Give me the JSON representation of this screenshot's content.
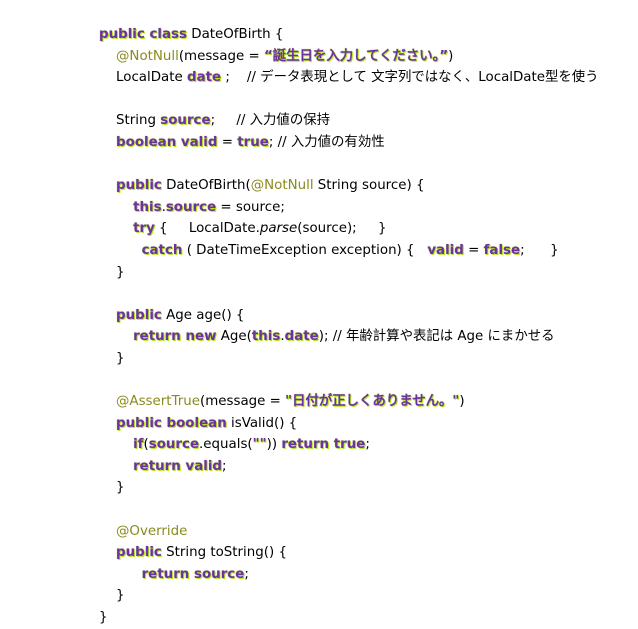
{
  "code": {
    "lines": [
      [
        [
          "kw",
          "public class"
        ],
        [
          "t",
          " DateOfBirth {"
        ]
      ],
      [
        [
          "t",
          "    "
        ],
        [
          "ann",
          "@NotNull"
        ],
        [
          "t",
          "(message = "
        ],
        [
          "str",
          "“誕生日を入力してください。”"
        ],
        [
          "t",
          ")"
        ]
      ],
      [
        [
          "t",
          "    LocalDate "
        ],
        [
          "kw",
          "date"
        ],
        [
          "t",
          " ;    // データ表現として 文字列ではなく、LocalDate型を使う"
        ]
      ],
      [
        [
          "t",
          ""
        ]
      ],
      [
        [
          "t",
          "    String "
        ],
        [
          "kw",
          "source"
        ],
        [
          "t",
          ";     // 入力値の保持"
        ]
      ],
      [
        [
          "t",
          "    "
        ],
        [
          "kw",
          "boolean valid"
        ],
        [
          "t",
          " = "
        ],
        [
          "kw",
          "true"
        ],
        [
          "t",
          "; // 入力値の有効性"
        ]
      ],
      [
        [
          "t",
          ""
        ]
      ],
      [
        [
          "t",
          "    "
        ],
        [
          "kw",
          "public"
        ],
        [
          "t",
          " DateOfBirth("
        ],
        [
          "ann",
          "@NotNull"
        ],
        [
          "t",
          " String source) {"
        ]
      ],
      [
        [
          "t",
          "        "
        ],
        [
          "kw",
          "this"
        ],
        [
          "t",
          "."
        ],
        [
          "kw",
          "source"
        ],
        [
          "t",
          " = source;"
        ]
      ],
      [
        [
          "t",
          "        "
        ],
        [
          "kw",
          "try"
        ],
        [
          "t",
          " {     LocalDate."
        ],
        [
          "it",
          "parse"
        ],
        [
          "t",
          "(source);     }"
        ]
      ],
      [
        [
          "t",
          "          "
        ],
        [
          "kw",
          "catch"
        ],
        [
          "t",
          " ( DateTimeException exception) {   "
        ],
        [
          "kw",
          "valid"
        ],
        [
          "t",
          " = "
        ],
        [
          "kw",
          "false"
        ],
        [
          "t",
          ";      }"
        ]
      ],
      [
        [
          "t",
          "    }"
        ]
      ],
      [
        [
          "t",
          ""
        ]
      ],
      [
        [
          "t",
          "    "
        ],
        [
          "kw",
          "public"
        ],
        [
          "t",
          " Age age() {"
        ]
      ],
      [
        [
          "t",
          "        "
        ],
        [
          "kw",
          "return new"
        ],
        [
          "t",
          " Age("
        ],
        [
          "kw",
          "this"
        ],
        [
          "t",
          "."
        ],
        [
          "kw",
          "date"
        ],
        [
          "t",
          "); // 年齢計算や表記は Age にまかせる"
        ]
      ],
      [
        [
          "t",
          "    }"
        ]
      ],
      [
        [
          "t",
          ""
        ]
      ],
      [
        [
          "t",
          "    "
        ],
        [
          "ann",
          "@AssertTrue"
        ],
        [
          "t",
          "(message = "
        ],
        [
          "str",
          "\"日付が正しくありません。\""
        ],
        [
          "t",
          ")"
        ]
      ],
      [
        [
          "t",
          "    "
        ],
        [
          "kw",
          "public boolean"
        ],
        [
          "t",
          " isValid() {"
        ]
      ],
      [
        [
          "t",
          "        "
        ],
        [
          "kw",
          "if"
        ],
        [
          "t",
          "("
        ],
        [
          "kw",
          "source"
        ],
        [
          "t",
          ".equals("
        ],
        [
          "str",
          "\"\""
        ],
        [
          "t",
          ")) "
        ],
        [
          "kw",
          "return true"
        ],
        [
          "t",
          ";"
        ]
      ],
      [
        [
          "t",
          "        "
        ],
        [
          "kw",
          "return valid"
        ],
        [
          "t",
          ";"
        ]
      ],
      [
        [
          "t",
          "    }"
        ]
      ],
      [
        [
          "t",
          ""
        ]
      ],
      [
        [
          "t",
          "    "
        ],
        [
          "ann",
          "@Override"
        ]
      ],
      [
        [
          "t",
          "    "
        ],
        [
          "kw",
          "public"
        ],
        [
          "t",
          " String toString() {"
        ]
      ],
      [
        [
          "t",
          "          "
        ],
        [
          "kw",
          "return source"
        ],
        [
          "t",
          ";"
        ]
      ],
      [
        [
          "t",
          "    }"
        ]
      ],
      [
        [
          "t",
          "}"
        ]
      ]
    ]
  },
  "colors": {
    "keyword": "#7030a0",
    "keyword_glow": "#b4e61e",
    "annotation": "#8a8a1e",
    "text": "#000000",
    "background": "#ffffff"
  }
}
